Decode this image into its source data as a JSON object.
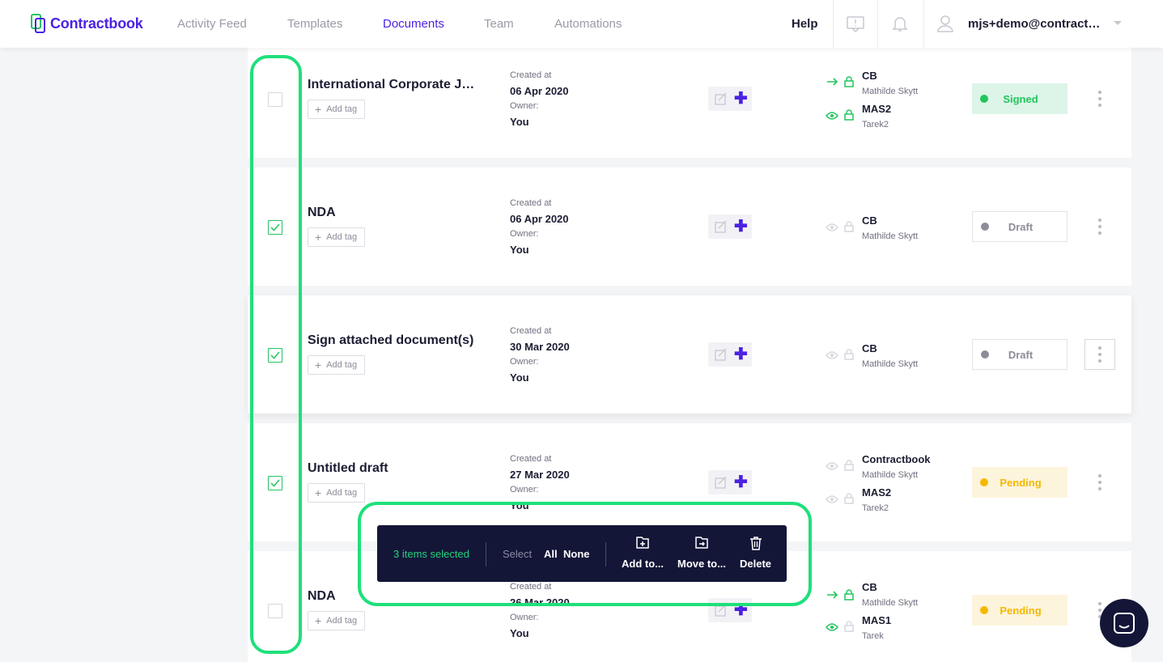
{
  "app": {
    "brand": "Contractbook",
    "accent_color": "#4c22e3",
    "annotation_color": "#1ee07a"
  },
  "nav": {
    "items": [
      {
        "label": "Activity Feed",
        "active": false
      },
      {
        "label": "Templates",
        "active": false
      },
      {
        "label": "Documents",
        "active": true
      },
      {
        "label": "Team",
        "active": false
      },
      {
        "label": "Automations",
        "active": false
      }
    ],
    "help": "Help",
    "icons": [
      "feedback-icon",
      "bell-icon",
      "user-icon"
    ],
    "user": "mjs+demo@contractbook.com"
  },
  "documents": [
    {
      "title": "International Corporate Joint Venture Agreement",
      "checked": false,
      "tag_button": "Add tag",
      "created_label": "Created at",
      "created": "06 Apr 2020",
      "owner_label": "Owner:",
      "owner": "You",
      "parties": [
        {
          "name": "CB",
          "person": "Mathilde Skytt",
          "icon": "arrow-icon",
          "lock": "green"
        },
        {
          "name": "MAS2",
          "person": "Tarek2",
          "icon": "eye-icon",
          "lock": "green"
        }
      ],
      "status": "Signed",
      "status_type": "signed"
    },
    {
      "title": "NDA",
      "checked": true,
      "tag_button": "Add tag",
      "created_label": "Created at",
      "created": "06 Apr 2020",
      "owner_label": "Owner:",
      "owner": "You",
      "parties": [
        {
          "name": "CB",
          "person": "Mathilde Skytt",
          "icon": "eye-icon",
          "lock": "grey"
        }
      ],
      "status": "Draft",
      "status_type": "draft"
    },
    {
      "title": "Sign attached document(s)",
      "checked": true,
      "tag_button": "Add tag",
      "created_label": "Created at",
      "created": "30 Mar 2020",
      "owner_label": "Owner:",
      "owner": "You",
      "parties": [
        {
          "name": "CB",
          "person": "Mathilde Skytt",
          "icon": "eye-icon",
          "lock": "grey"
        }
      ],
      "status": "Draft",
      "status_type": "draft"
    },
    {
      "title": "Untitled draft",
      "checked": true,
      "tag_button": "Add tag",
      "created_label": "Created at",
      "created": "27 Mar 2020",
      "owner_label": "Owner:",
      "owner": "You",
      "parties": [
        {
          "name": "Contractbook",
          "person": "Mathilde Skytt",
          "icon": "eye-icon",
          "lock": "grey"
        },
        {
          "name": "MAS2",
          "person": "Tarek2",
          "icon": "eye-icon",
          "lock": "grey"
        }
      ],
      "status": "Pending",
      "status_type": "pending"
    },
    {
      "title": "NDA",
      "checked": false,
      "tag_button": "Add tag",
      "created_label": "Created at",
      "created": "26 Mar 2020",
      "owner_label": "Owner:",
      "owner": "You",
      "parties": [
        {
          "name": "CB",
          "person": "Mathilde Skytt",
          "icon": "arrow-icon",
          "lock": "green"
        },
        {
          "name": "MAS1",
          "person": "Tarek",
          "icon": "eye-icon",
          "lock": "grey"
        }
      ],
      "status": "Pending",
      "status_type": "pending"
    }
  ],
  "selection_bar": {
    "count": "3 items selected",
    "select_label": "Select",
    "all": "All",
    "none": "None",
    "add_to": "Add to...",
    "move_to": "Move to...",
    "delete": "Delete"
  }
}
